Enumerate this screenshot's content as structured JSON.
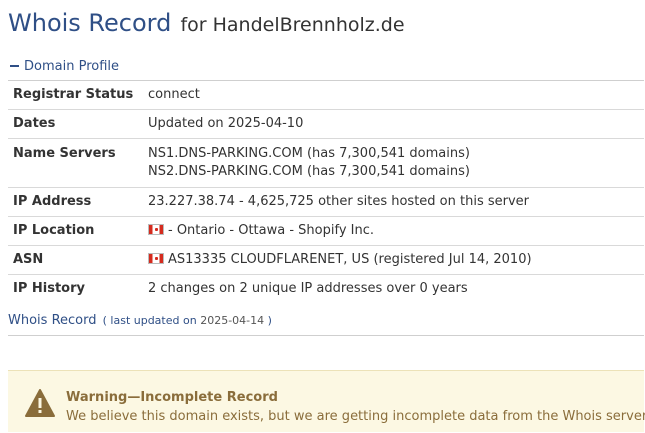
{
  "title": {
    "main": "Whois Record",
    "sub": "for HandelBrennholz.de"
  },
  "profile": {
    "section_label": "Domain Profile",
    "rows": [
      {
        "label": "Registrar Status",
        "value": "connect"
      },
      {
        "label": "Dates",
        "value": "Updated on 2025-04-10"
      },
      {
        "label": "Name Servers",
        "lines": [
          "NS1.DNS-PARKING.COM (has 7,300,541 domains)",
          "NS2.DNS-PARKING.COM (has 7,300,541 domains)"
        ]
      },
      {
        "label": "IP Address",
        "value": "23.227.38.74 - 4,625,725 other sites hosted on this server"
      },
      {
        "label": "IP Location",
        "value": "- Ontario - Ottawa - Shopify Inc.",
        "flag": "flag-canada-icon"
      },
      {
        "label": "ASN",
        "value": "AS13335 CLOUDFLARENET, US (registered Jul 14, 2010)",
        "flag": "flag-canada-icon"
      },
      {
        "label": "IP History",
        "value": "2 changes on 2 unique IP addresses over 0 years"
      }
    ]
  },
  "whois": {
    "label": "Whois Record",
    "meta_open": "( last updated on",
    "meta_date": "2025-04-14",
    "meta_close": ")"
  },
  "warning": {
    "title": "Warning—Incomplete Record",
    "message": "We believe this domain exists, but we are getting incomplete data from the Whois server.",
    "icon": "warning-triangle-icon",
    "colors": {
      "background": "#fcf8e3",
      "text": "#8a6d3b",
      "icon": "#8a6d3b"
    }
  },
  "colors": {
    "accent": "#2f4f86",
    "text": "#333333"
  }
}
